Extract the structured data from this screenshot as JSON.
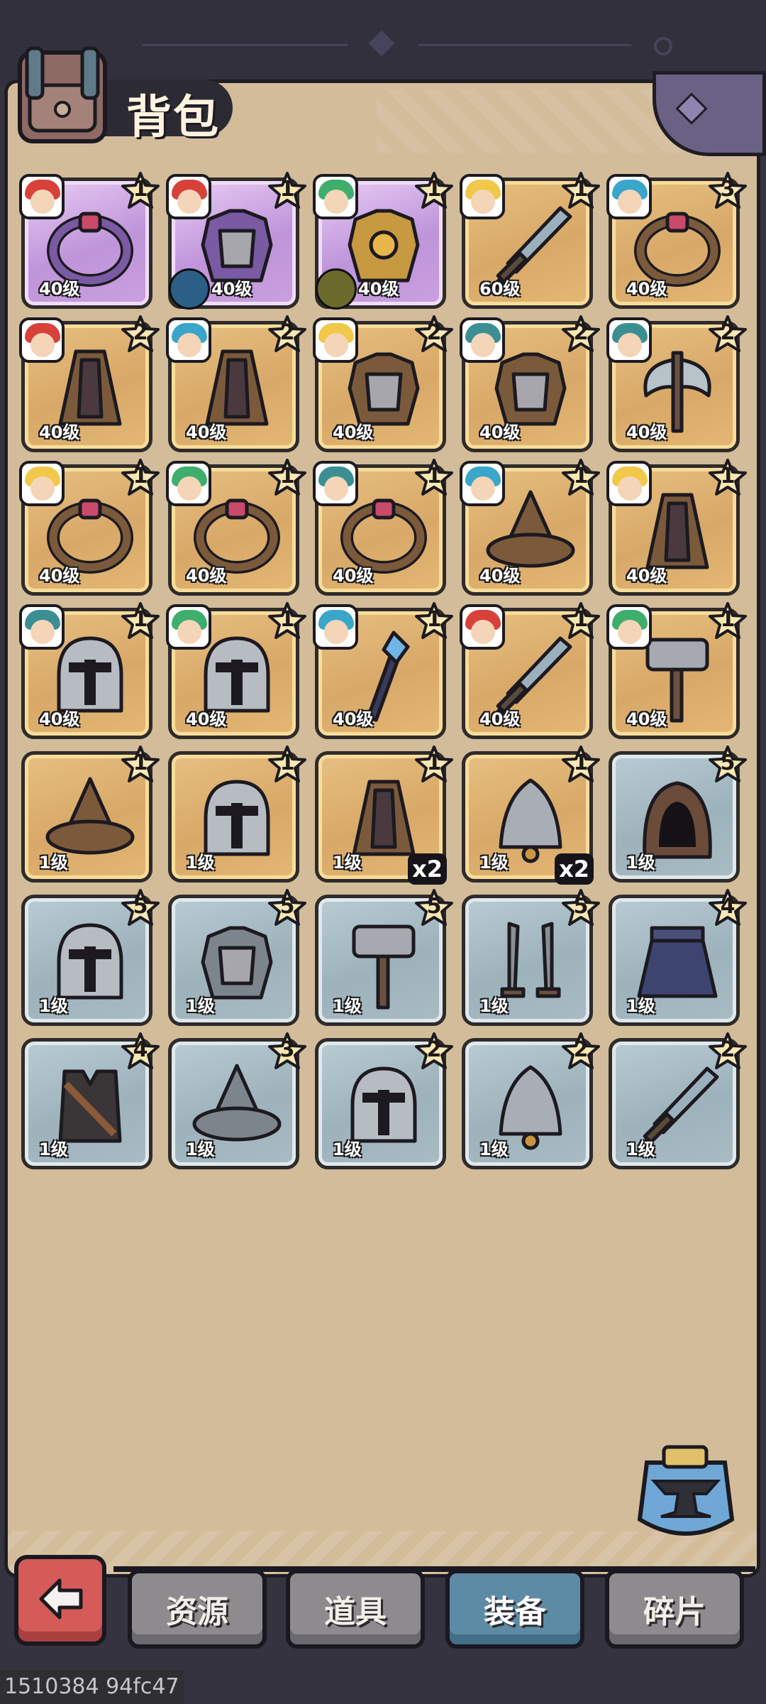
{
  "header": {
    "title": "背包"
  },
  "items": [
    {
      "rarity": "purple",
      "level": "40级",
      "stars": "1",
      "hero": "red",
      "shape": "ring",
      "element": ""
    },
    {
      "rarity": "purple",
      "level": "40级",
      "stars": "1",
      "hero": "red",
      "shape": "armor",
      "element": "water"
    },
    {
      "rarity": "purple",
      "level": "40级",
      "stars": "1",
      "hero": "green",
      "shape": "armor-gold",
      "element": "earth"
    },
    {
      "rarity": "gold",
      "level": "60级",
      "stars": "1",
      "hero": "blonde",
      "shape": "sword",
      "element": ""
    },
    {
      "rarity": "gold",
      "level": "40级",
      "stars": "3",
      "hero": "cyan",
      "shape": "ring",
      "element": ""
    },
    {
      "rarity": "gold",
      "level": "40级",
      "stars": "2",
      "hero": "red",
      "shape": "cloak",
      "element": ""
    },
    {
      "rarity": "gold",
      "level": "40级",
      "stars": "2",
      "hero": "cyan",
      "shape": "cloak",
      "element": ""
    },
    {
      "rarity": "gold",
      "level": "40级",
      "stars": "2",
      "hero": "blonde",
      "shape": "armor",
      "element": ""
    },
    {
      "rarity": "gold",
      "level": "40级",
      "stars": "2",
      "hero": "teal",
      "shape": "armor",
      "element": ""
    },
    {
      "rarity": "gold",
      "level": "40级",
      "stars": "2",
      "hero": "teal",
      "shape": "axe",
      "element": ""
    },
    {
      "rarity": "gold",
      "level": "40级",
      "stars": "1",
      "hero": "blonde",
      "shape": "ring",
      "element": ""
    },
    {
      "rarity": "gold",
      "level": "40级",
      "stars": "1",
      "hero": "green",
      "shape": "ring",
      "element": ""
    },
    {
      "rarity": "gold",
      "level": "40级",
      "stars": "1",
      "hero": "teal",
      "shape": "ring",
      "element": ""
    },
    {
      "rarity": "gold",
      "level": "40级",
      "stars": "1",
      "hero": "cyan",
      "shape": "hat",
      "element": ""
    },
    {
      "rarity": "gold",
      "level": "40级",
      "stars": "1",
      "hero": "blonde",
      "shape": "cloak",
      "element": ""
    },
    {
      "rarity": "gold",
      "level": "40级",
      "stars": "1",
      "hero": "teal",
      "shape": "helmet",
      "element": ""
    },
    {
      "rarity": "gold",
      "level": "40级",
      "stars": "1",
      "hero": "green",
      "shape": "helmet",
      "element": ""
    },
    {
      "rarity": "gold",
      "level": "40级",
      "stars": "1",
      "hero": "cyan",
      "shape": "staff",
      "element": ""
    },
    {
      "rarity": "gold",
      "level": "40级",
      "stars": "1",
      "hero": "red",
      "shape": "sword",
      "element": ""
    },
    {
      "rarity": "gold",
      "level": "40级",
      "stars": "1",
      "hero": "green",
      "shape": "hammer",
      "element": ""
    },
    {
      "rarity": "gold",
      "level": "1级",
      "stars": "1",
      "hero": "",
      "shape": "hat",
      "element": ""
    },
    {
      "rarity": "gold",
      "level": "1级",
      "stars": "1",
      "hero": "",
      "shape": "helmet",
      "element": ""
    },
    {
      "rarity": "gold",
      "level": "1级",
      "stars": "1",
      "hero": "",
      "shape": "cloak",
      "element": "",
      "count": "x2"
    },
    {
      "rarity": "gold",
      "level": "1级",
      "stars": "1",
      "hero": "",
      "shape": "bell",
      "element": "",
      "count": "x2"
    },
    {
      "rarity": "gray",
      "level": "1级",
      "stars": "5",
      "hero": "",
      "shape": "hood",
      "element": ""
    },
    {
      "rarity": "gray",
      "level": "1级",
      "stars": "5",
      "hero": "",
      "shape": "helmet",
      "element": ""
    },
    {
      "rarity": "gray",
      "level": "1级",
      "stars": "5",
      "hero": "",
      "shape": "armor",
      "element": ""
    },
    {
      "rarity": "gray",
      "level": "1级",
      "stars": "5",
      "hero": "",
      "shape": "hammer",
      "element": ""
    },
    {
      "rarity": "gray",
      "level": "1级",
      "stars": "5",
      "hero": "",
      "shape": "daggers",
      "element": ""
    },
    {
      "rarity": "gray",
      "level": "1级",
      "stars": "4",
      "hero": "",
      "shape": "skirt",
      "element": ""
    },
    {
      "rarity": "gray",
      "level": "1级",
      "stars": "4",
      "hero": "",
      "shape": "vest",
      "element": ""
    },
    {
      "rarity": "gray",
      "level": "1级",
      "stars": "3",
      "hero": "",
      "shape": "hat",
      "element": ""
    },
    {
      "rarity": "gray",
      "level": "1级",
      "stars": "2",
      "hero": "",
      "shape": "helmet",
      "element": ""
    },
    {
      "rarity": "gray",
      "level": "1级",
      "stars": "2",
      "hero": "",
      "shape": "bell",
      "element": ""
    },
    {
      "rarity": "gray",
      "level": "1级",
      "stars": "2",
      "hero": "",
      "shape": "sword",
      "element": ""
    }
  ],
  "tabs": [
    {
      "label": "资源",
      "active": false
    },
    {
      "label": "道具",
      "active": false
    },
    {
      "label": "装备",
      "active": true
    },
    {
      "label": "碎片",
      "active": false
    }
  ],
  "footer": {
    "id_text": "1510384 94fc47"
  },
  "icons": {
    "back": "back-arrow-icon",
    "forge": "anvil-icon",
    "bag": "backpack-icon"
  },
  "colors": {
    "purple": "#c9a0e0",
    "gold": "#ddb06e",
    "gray": "#a6b9c1",
    "active_tab": "#5d8ba6"
  }
}
